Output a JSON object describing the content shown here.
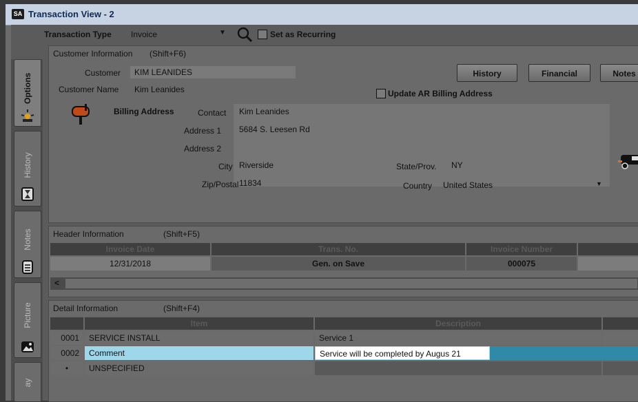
{
  "window": {
    "title": "Transaction View - 2",
    "app_badge": "SA"
  },
  "toolbar": {
    "transaction_type_label": "Transaction Type",
    "transaction_type_value": "Invoice",
    "set_recurring_label": "Set as Recurring"
  },
  "tabs": [
    "Options",
    "History",
    "Notes",
    "Picture",
    "ay"
  ],
  "customer": {
    "section_title": "Customer Information",
    "section_shortcut": "(Shift+F6)",
    "customer_label": "Customer",
    "customer_value": "KIM LEANIDES",
    "name_label": "Customer Name",
    "name_value": "Kim Leanides",
    "update_ar_label": "Update AR Billing Address",
    "billing_label": "Billing Address",
    "contact_label": "Contact",
    "contact_value": "Kim Leanides",
    "address1_label": "Address 1",
    "address1_value": "5684 S. Leesen Rd",
    "address2_label": "Address 2",
    "address2_value": "",
    "city_label": "City",
    "city_value": "Riverside",
    "state_label": "State/Prov.",
    "state_value": "NY",
    "zip_label": "Zip/Postal",
    "zip_value": "11834",
    "country_label": "Country",
    "country_value": "United States"
  },
  "buttons": {
    "history": "History",
    "financial": "Financial",
    "notes": "Notes"
  },
  "header": {
    "section_title": "Header Information",
    "section_shortcut": "(Shift+F5)",
    "columns": [
      "Invoice Date",
      "Trans. No.",
      "Invoice Number"
    ],
    "values": [
      "12/31/2018",
      "Gen. on Save",
      "000075"
    ]
  },
  "detail": {
    "section_title": "Detail Information",
    "section_shortcut": "(Shift+F4)",
    "columns": [
      "Item",
      "Description"
    ],
    "rows": [
      {
        "num": "0001",
        "item": "SERVICE INSTALL",
        "description": "Service 1"
      },
      {
        "num": "0002",
        "item": "Comment",
        "description": "Service will be completed by Augus 21"
      },
      {
        "num": "•",
        "item": "UNSPECIFIED",
        "description": ""
      }
    ]
  },
  "scroll_left_glyph": "<"
}
